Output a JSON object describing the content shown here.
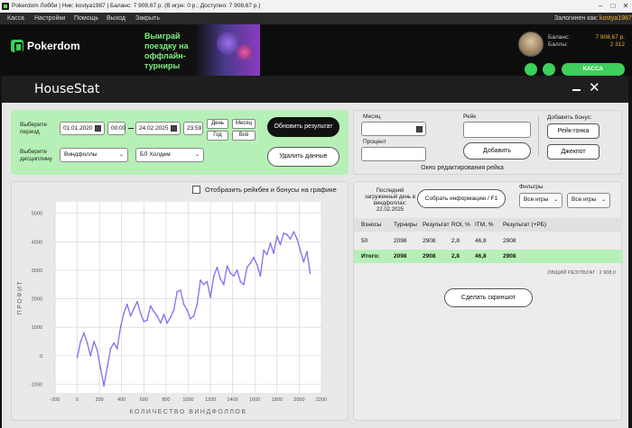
{
  "titlebar": {
    "text": "Pokerdom Лобби | Ник: kostya1987 | Баланс: 7 908,67 р. (В игре: 0 р.; Доступно: 7 908,67 р.)"
  },
  "menu": {
    "items": [
      "Касса",
      "Настройки",
      "Помощь",
      "Выход",
      "Закрыть"
    ],
    "logged_label": "Залогинен как:",
    "logged_user": "kostya1987"
  },
  "lobby": {
    "logo": "Pokerdom",
    "banner": "Выиграй поездку на оффлайн-турниры",
    "balance_label": "Баланс:",
    "balance_value": "7 908,67 р.",
    "points_label": "Баллы:",
    "points_value": "2 312",
    "cashier": "КАССА"
  },
  "app": {
    "title": "HouseStat"
  },
  "period": {
    "label": "Выберите период",
    "date_from": "01.01.2020",
    "time_from": "00:00",
    "date_to": "24.02.2025",
    "time_to": "23:59",
    "day": "День",
    "month": "Месяц",
    "year": "Год",
    "all": "Всё",
    "refresh": "Обновить результат"
  },
  "discipline": {
    "label": "Выберите дисциплину",
    "type": "Виндфоллы",
    "game": "БЛ Холдем",
    "delete": "Удалить данные"
  },
  "rake": {
    "month_label": "Месяц",
    "percent_label": "Процент",
    "rake_label": "Рейк",
    "add": "Добавить",
    "window_label": "Окно редактирования рейка",
    "bonus_label": "Добавить бонус:",
    "rake_race": "Рейк-гонка",
    "jackpot": "Джекпот"
  },
  "chart_toggle": {
    "label": "Отобразить рейкбек и бонусы на графике"
  },
  "info": {
    "last_loaded": "Последний загруженный день в виндфоллах: 22.02.2025",
    "collect": "Собрать информацию / F1",
    "filters_label": "Фильтры",
    "filter1": "Все игры",
    "filter2": "Все игры"
  },
  "table": {
    "headers": [
      "Взносы",
      "Турниры",
      "Результат",
      "ROI, %",
      "ITM, %",
      "Результат (+РБ)"
    ],
    "rows": [
      [
        "50",
        "2098",
        "2908",
        "2,8",
        "46,8",
        "2908"
      ]
    ],
    "total": [
      "Итого:",
      "2098",
      "2908",
      "2,8",
      "46,8",
      "2908"
    ],
    "overall": "ОБЩИЙ РЕЗУЛЬТАТ : 2 908,0",
    "screenshot": "Сделать скриншот"
  },
  "colors": {
    "accent": "#3ecf5c",
    "panel_green": "#b6f0b6",
    "line": "#8a6cf0",
    "orange": "#f0b030"
  },
  "chart_data": {
    "type": "line",
    "xlabel": "КОЛИЧЕСТВО ВИНДФОЛЛОВ",
    "ylabel": "ПРОФИТ",
    "xticks": [
      -200,
      0,
      200,
      400,
      600,
      800,
      1000,
      1200,
      1400,
      1600,
      1800,
      2000,
      2200
    ],
    "yticks": [
      -1000,
      0,
      1000,
      2000,
      3000,
      4000,
      5000
    ],
    "xlim": [
      -200,
      2200
    ],
    "ylim": [
      -1300,
      5400
    ],
    "grid": true,
    "series": [
      {
        "x": [
          0,
          30,
          60,
          90,
          120,
          150,
          180,
          210,
          240,
          270,
          300,
          330,
          360,
          390,
          420,
          450,
          480,
          510,
          540,
          570,
          600,
          630,
          660,
          690,
          720,
          750,
          780,
          810,
          840,
          870,
          900,
          930,
          960,
          990,
          1020,
          1050,
          1080,
          1110,
          1140,
          1170,
          1200,
          1230,
          1260,
          1290,
          1320,
          1350,
          1380,
          1410,
          1440,
          1470,
          1500,
          1530,
          1560,
          1590,
          1620,
          1650,
          1680,
          1710,
          1740,
          1770,
          1800,
          1830,
          1860,
          1890,
          1920,
          1950,
          1980,
          2010,
          2040,
          2070,
          2098
        ],
        "y": [
          -50,
          500,
          800,
          450,
          0,
          500,
          200,
          -450,
          -1050,
          -400,
          250,
          450,
          250,
          1000,
          1500,
          1800,
          1400,
          1650,
          1900,
          1500,
          1200,
          1250,
          1750,
          1550,
          1400,
          1150,
          1450,
          1150,
          1350,
          1600,
          2250,
          2300,
          1800,
          1600,
          1300,
          1400,
          1800,
          2650,
          2500,
          2600,
          2050,
          2800,
          3100,
          2700,
          2500,
          3150,
          2900,
          2800,
          3000,
          2600,
          2500,
          3100,
          3250,
          3450,
          3200,
          2800,
          3700,
          3550,
          3950,
          3600,
          4200,
          3900,
          4300,
          4250,
          4100,
          4350,
          4100,
          3700,
          3300,
          3650,
          2900
        ]
      }
    ]
  }
}
